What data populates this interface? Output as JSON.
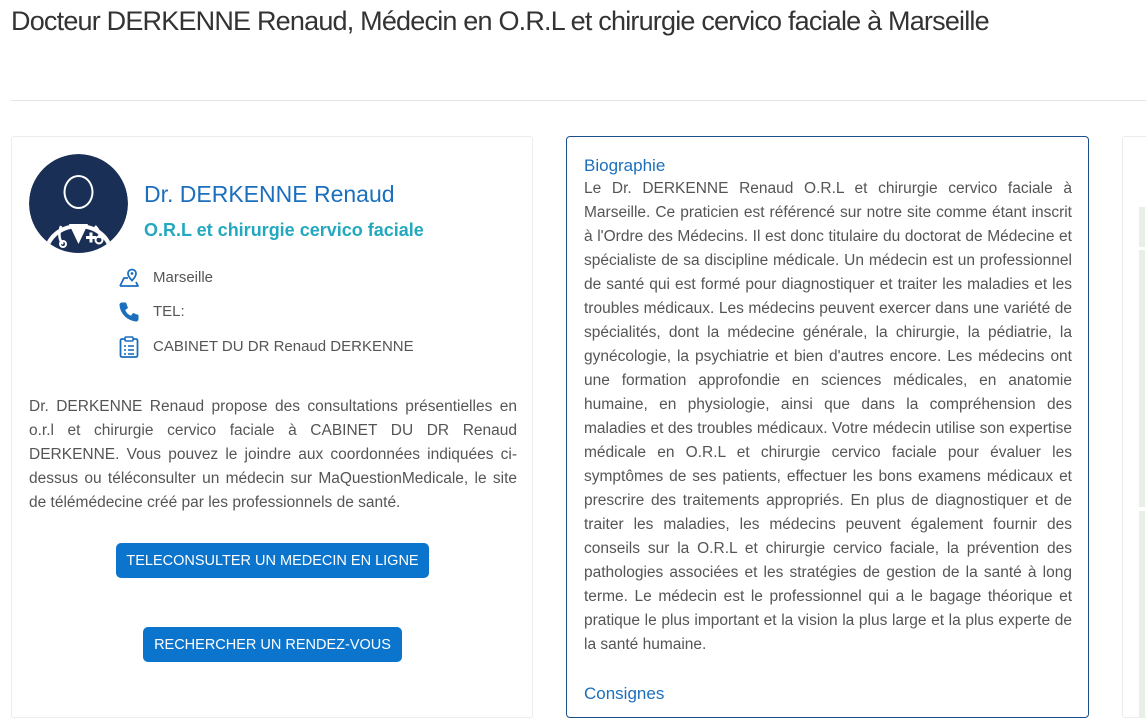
{
  "page": {
    "title": "Docteur DERKENNE Renaud, Médecin en O.R.L et chirurgie cervico faciale à Marseille"
  },
  "profile": {
    "name": "Dr. DERKENNE Renaud",
    "specialty": "O.R.L et chirurgie cervico faciale",
    "city": "Marseille",
    "phone_label": "TEL:",
    "practice": "CABINET DU DR Renaud DERKENNE",
    "description": "Dr. DERKENNE Renaud propose des consultations présentielles en o.r.l et chirurgie cervico faciale à CABINET DU DR Renaud DERKENNE. Vous pouvez le joindre aux coordonnées indiquées ci-dessus ou téléconsulter un médecin sur MaQuestionMedicale, le site de télémédecine créé par les professionnels de santé.",
    "icons": {
      "location": "map-pin-icon",
      "phone": "phone-icon",
      "practice": "clipboard-icon",
      "avatar": "doctor-avatar-icon"
    }
  },
  "buttons": {
    "teleconsult": "TELECONSULTER UN MEDECIN EN LIGNE",
    "search_rdv": "RECHERCHER UN RENDEZ-VOUS"
  },
  "biography": {
    "title": "Biographie",
    "text": "Le Dr. DERKENNE Renaud O.R.L et chirurgie cervico faciale à Marseille. Ce praticien est référencé sur notre site comme étant inscrit à l'Ordre des Médecins. Il est donc titulaire du doctorat de Médecine et spécialiste de sa discipline médicale. Un médecin est un professionnel de santé qui est formé pour diagnostiquer et traiter les maladies et les troubles médicaux. Les médecins peuvent exercer dans une variété de spécialités, dont la médecine générale, la chirurgie, la pédiatrie, la gynécologie, la psychiatrie et bien d'autres encore. Les médecins ont une formation approfondie en sciences médicales, en anatomie humaine, en physiologie, ainsi que dans la compréhension des maladies et des troubles médicaux. Votre médecin utilise son expertise médicale en O.R.L et chirurgie cervico faciale pour évaluer les symptômes de ses patients, effectuer les bons examens médicaux et prescrire des traitements appropriés. En plus de diagnostiquer et de traiter les maladies, les médecins peuvent également fournir des conseils sur la O.R.L et chirurgie cervico faciale, la prévention des pathologies associées et les stratégies de gestion de la santé à long terme. Le médecin est le professionnel qui a le bagage théorique et pratique le plus important et la vision la plus large et la plus experte de la santé humaine.",
    "next_section": "Consignes"
  },
  "colors": {
    "brand_blue": "#1c6fbd",
    "teal": "#23a8bf",
    "button": "#0b74cc"
  }
}
